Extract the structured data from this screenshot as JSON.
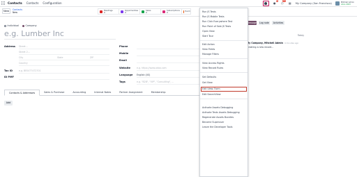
{
  "topbar": {
    "app_name": "Contacts",
    "menu": [
      "Contacts",
      "Configuration"
    ],
    "chat_badge": "6",
    "activity_badge": "15",
    "company": "My Company (San Francisco)",
    "user_name": "Mitchell Admin",
    "db_name": "odoo-2023"
  },
  "control": {
    "new_label": "New",
    "breadcrumb_parent": "Contacts",
    "breadcrumb_current": "New",
    "smart_buttons": [
      {
        "label": "Meetings",
        "value": "0",
        "color": "#dc2626"
      },
      {
        "label": "Opportunities",
        "value": "0",
        "color": "#7c3aed"
      },
      {
        "label": "Sales",
        "value": "0",
        "color": "#16a34a"
      },
      {
        "label": "Subscriptions",
        "value": "0",
        "color": "#db2777"
      },
      {
        "label": "Purch",
        "value": "",
        "color": "#ea580c"
      }
    ]
  },
  "form": {
    "company_type": [
      "Individual",
      "Company"
    ],
    "name_placeholder": "e.g. Lumber Inc",
    "address_label": "Address",
    "street_ph": "Street...",
    "street2_ph": "Street 2...",
    "city_ph": "City",
    "state_ph": "State",
    "zip_ph": "ZIP",
    "country_ph": "Country",
    "taxid_label": "Tax ID",
    "taxid_ph": "e.g. BE0477472701",
    "idpmf_label": "ID PMF",
    "phone_label": "Phone",
    "mobile_label": "Mobile",
    "email_label": "Email",
    "website_label": "Website",
    "website_ph": "e.g. https://www.odoo.com",
    "language_label": "Language",
    "language_value": "English (US)",
    "tags_label": "Tags",
    "tags_ph": "e.g. \"B2B\", \"VIP\", \"Consulting\", ..."
  },
  "tabs": [
    "Contacts & Addresses",
    "Sales & Purchase",
    "Accounting",
    "Internal Notes",
    "Partner Assignment",
    "Membership"
  ],
  "add_label": "Add",
  "chatter": {
    "send_message": "Message",
    "log_note": "Log note",
    "activities": "Activities",
    "today": "Today",
    "author": "My Company, Mitchell Admin",
    "time": "4 minutes ago",
    "body": "Creating a new record..."
  },
  "dropdown": {
    "items": [
      "Run JS Tests",
      "Run JS Mobile Tests",
      "Run Click Everywhere Test",
      "Run Point of Sale JS Tests",
      "Open View",
      "Start Tour",
      "Edit Action",
      "View Fields",
      "Manage Filters",
      "View Access Rights",
      "View Record Rules",
      "Set Defaults",
      "Get View",
      "Edit View: Form",
      "Edit SearchView",
      "Activate Assets Debugging",
      "Activate Tests Assets Debugging",
      "Regenerate Assets Bundles",
      "Become Superuser",
      "Leave the Developer Tools"
    ]
  }
}
